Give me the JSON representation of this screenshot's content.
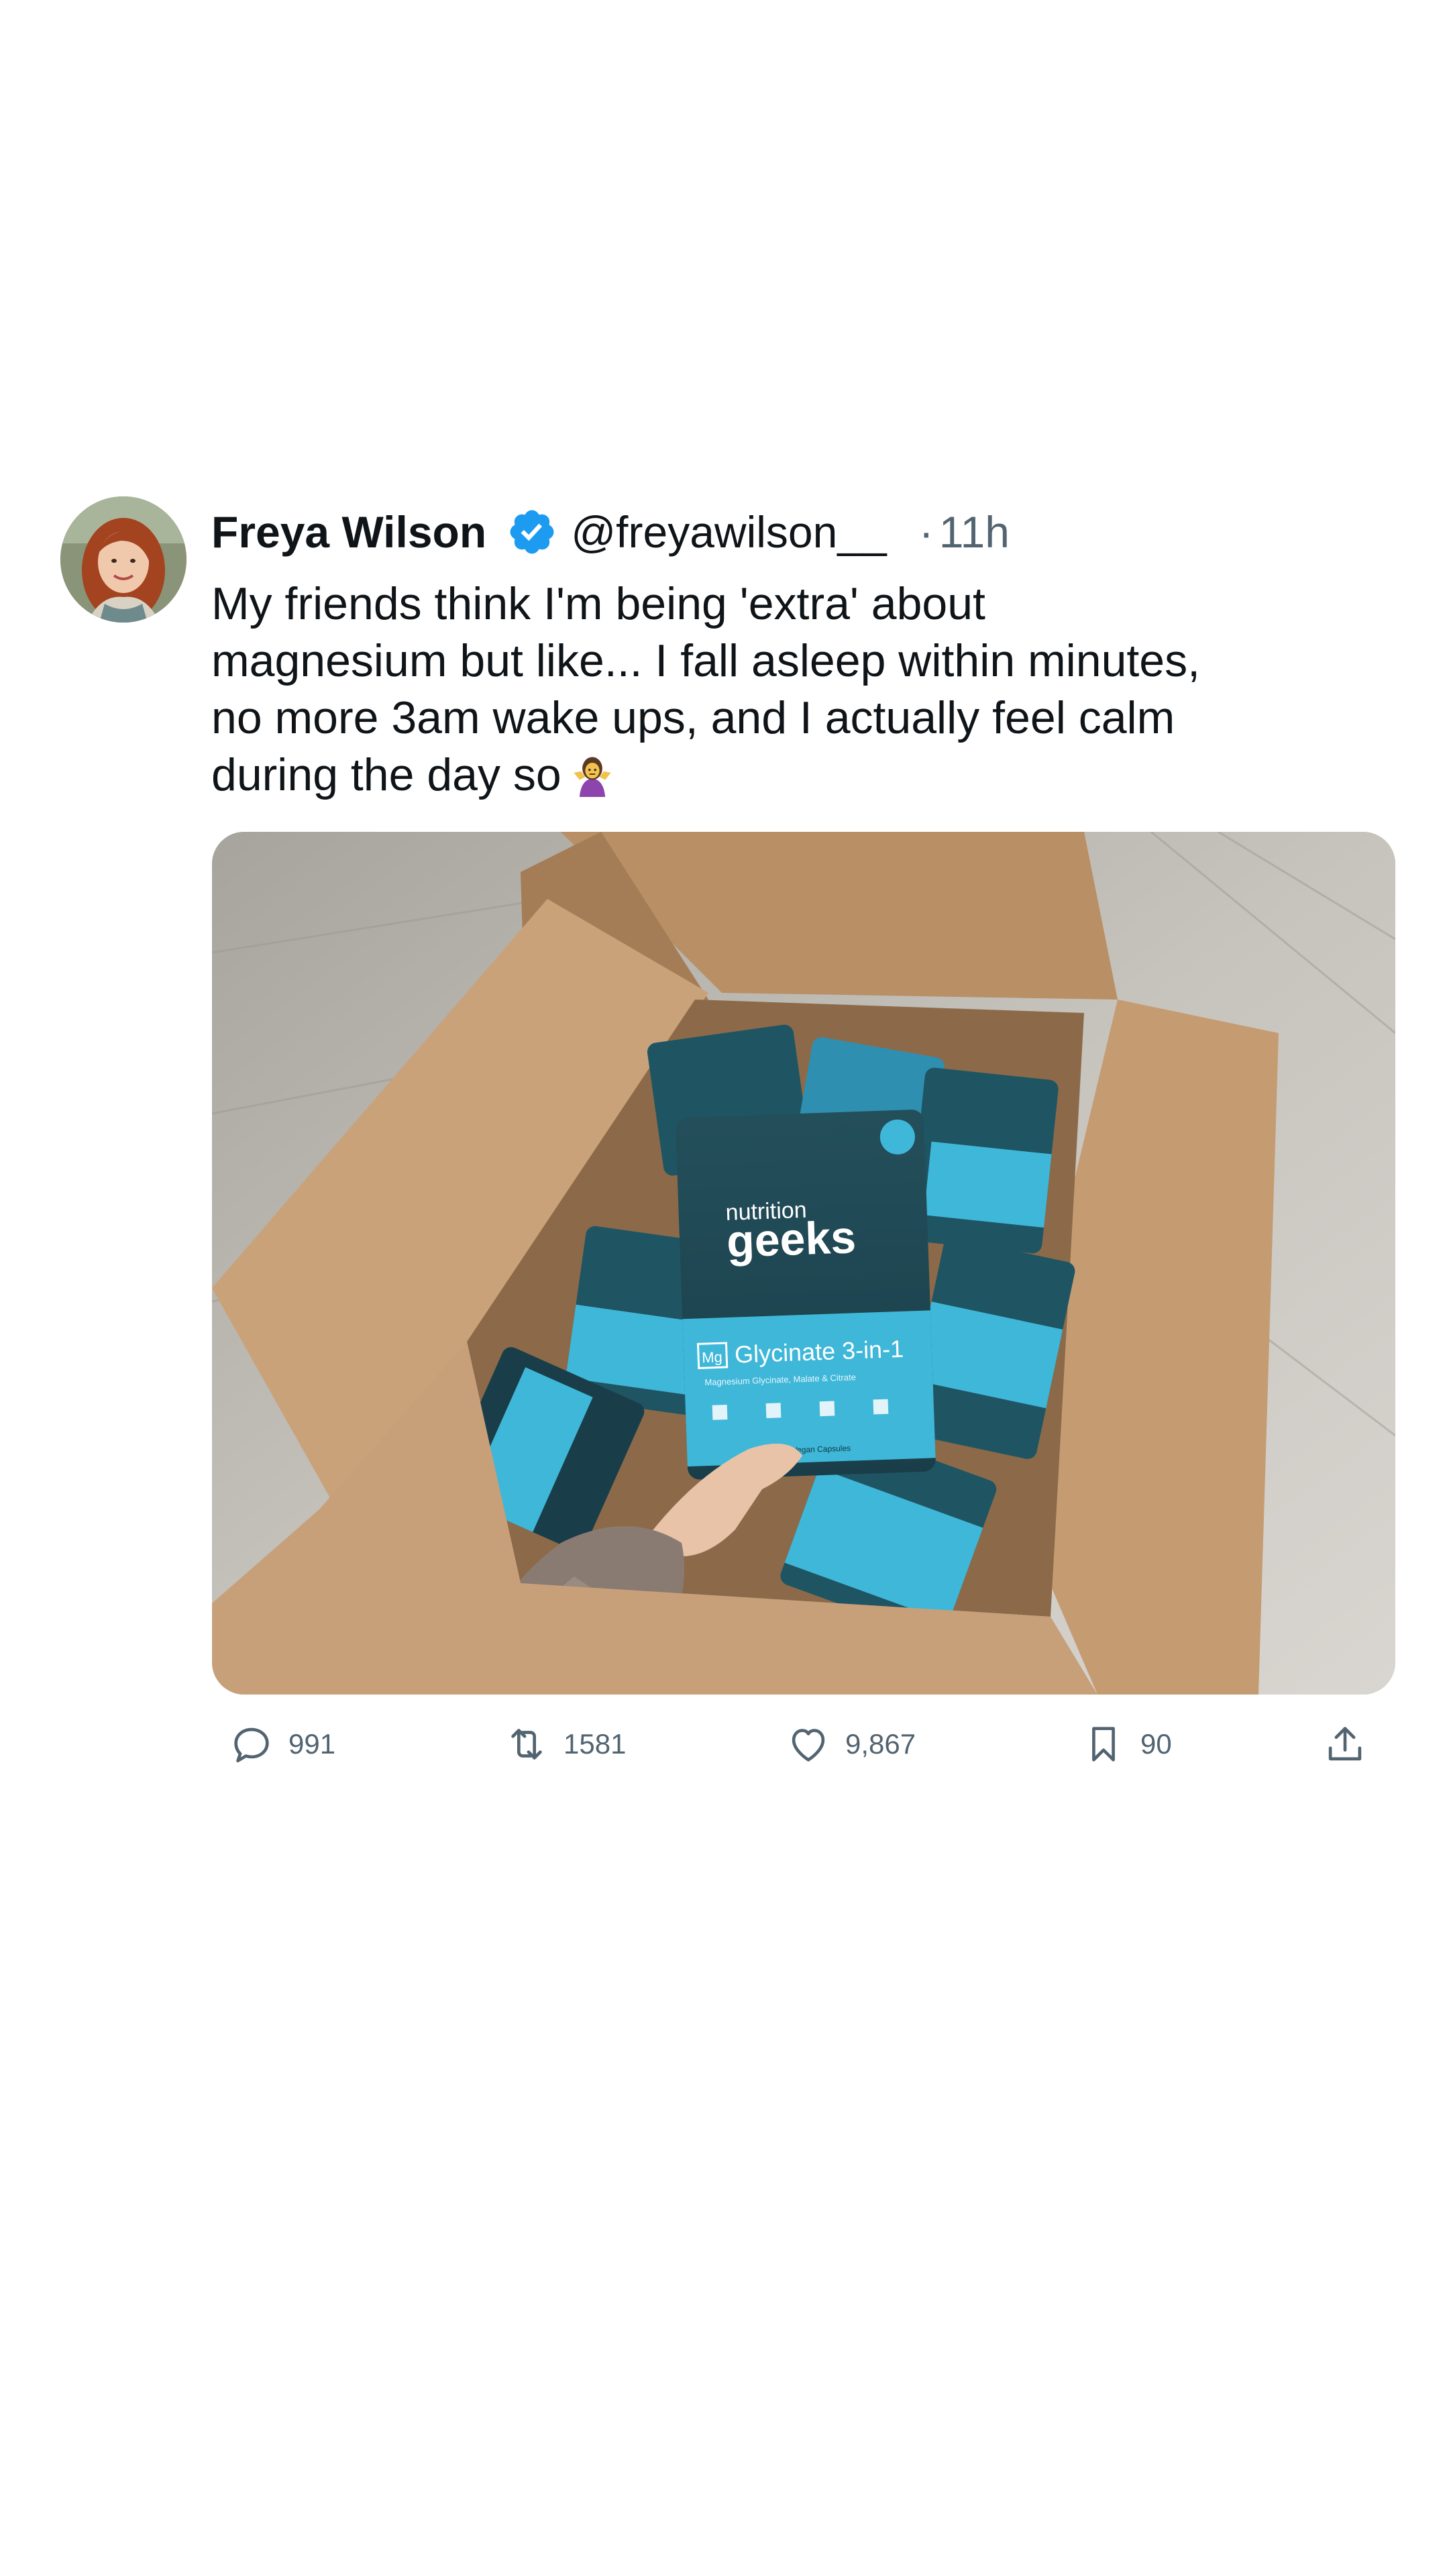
{
  "tweet": {
    "author": {
      "display_name": "Freya Wilson",
      "verified": true,
      "handle": "@freyawilson__",
      "avatar_icon": "user-avatar"
    },
    "separator": "·",
    "time": "11h",
    "text_lines": [
      "My friends think I'm being 'extra' about",
      "magnesium but like... I fall asleep within minutes,",
      "no more 3am wake ups, and I actually feel calm",
      "during the day so"
    ],
    "emoji": "person-shrugging-emoji",
    "media": {
      "brand_top": "nutrition",
      "brand_name": "geeks",
      "product_badge": "Mg",
      "product_name": "Glycinate 3-in-1",
      "product_subtitle": "Magnesium Glycinate, Malate & Citrate",
      "capsules": "90 Vegan Capsules"
    },
    "actions": {
      "replies": "991",
      "retweets": "1581",
      "likes": "9,867",
      "bookmarks": "90"
    }
  },
  "colors": {
    "text_primary": "#0f1419",
    "text_secondary": "#536471",
    "verified_blue": "#1d9bf0",
    "pouch_teal": "#1f5563",
    "pouch_label": "#3fb7d9",
    "cardboard": "#c9a27a"
  }
}
